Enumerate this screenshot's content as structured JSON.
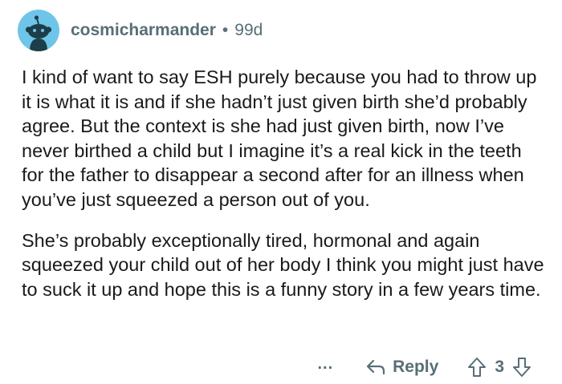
{
  "comment": {
    "username": "cosmicharmander",
    "separator": "•",
    "age": "99d",
    "avatar_icon": "reddit-snoo-icon",
    "avatar_color": "#6ec5e9",
    "paragraphs": [
      "I kind of want to say ESH purely because you had to throw up it is what it is and if she hadn’t just given birth she’d probably agree. But the context is she had just given birth, now I’ve never birthed a child but I imagine it’s a real kick in the teeth for the father to disappear a second after for an illness when you’ve just squeezed a person out of you.",
      "She’s probably exceptionally tired, hormonal and again squeezed your child out of her body I think you might just have to suck it up and hope this is a funny story in a few years time."
    ],
    "actions": {
      "more_label": "...",
      "reply_label": "Reply",
      "vote_count": "3"
    }
  }
}
